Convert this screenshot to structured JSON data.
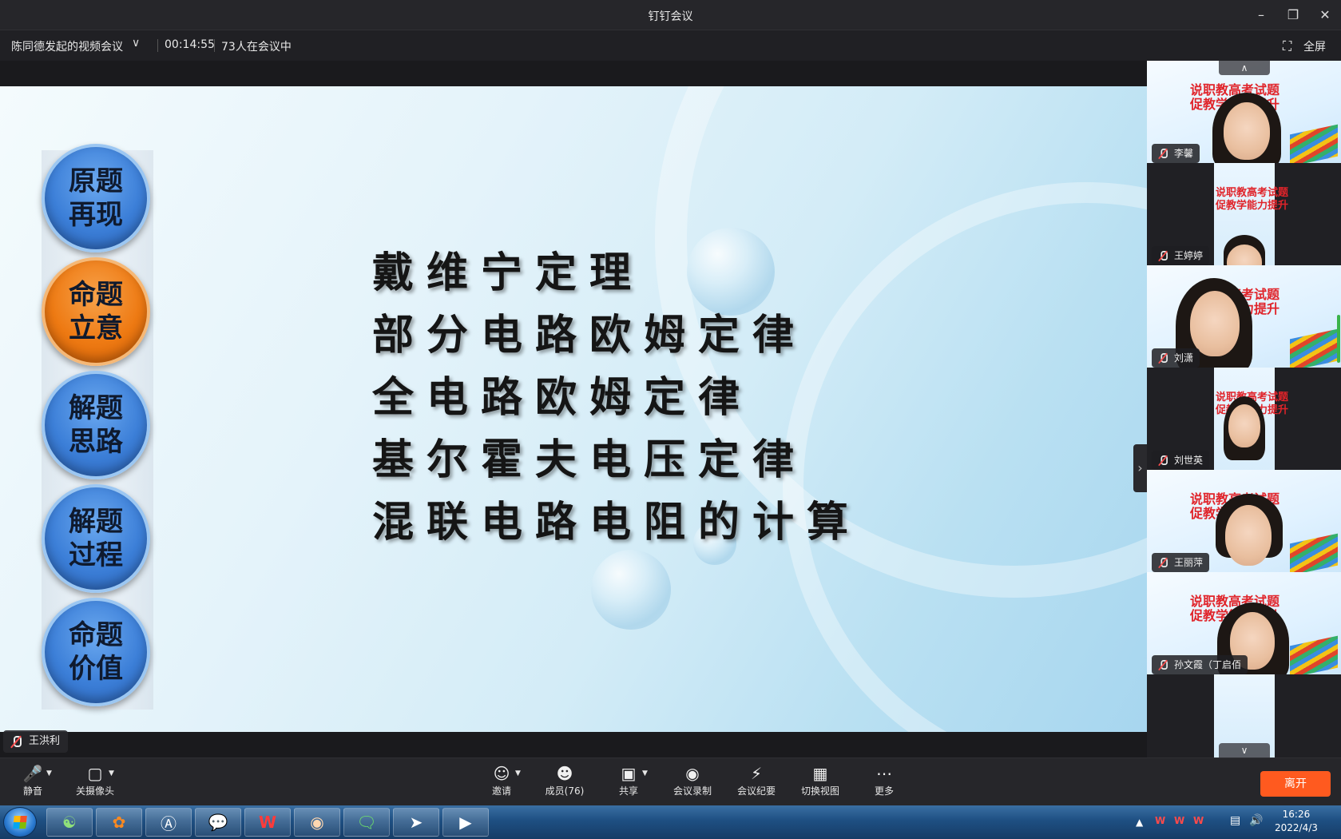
{
  "window": {
    "title": "钉钉会议",
    "minimize_icon": "minimize-icon",
    "restore_icon": "restore-icon",
    "close_icon": "close-icon"
  },
  "info_bar": {
    "meeting_name": "陈同德发起的视频会议",
    "timer": "00:14:55",
    "participants_text": "73人在会议中",
    "fullscreen_label": "全屏"
  },
  "slide": {
    "steps": [
      {
        "label": "原题\n再现",
        "active": false
      },
      {
        "label": "命题\n立意",
        "active": true
      },
      {
        "label": "解题\n思路",
        "active": false
      },
      {
        "label": "解题\n过程",
        "active": false
      },
      {
        "label": "命题\n价值",
        "active": false
      }
    ],
    "lines": [
      "戴维宁定理",
      "部分电路欧姆定律",
      "全电路欧姆定律",
      "基尔霍夫电压定律",
      "混联电路电阻的计算"
    ]
  },
  "speaker": {
    "name": "王洪利"
  },
  "banner_text": {
    "line1": "说职教高考试题",
    "line2": "促教学能力提升"
  },
  "participants": [
    {
      "name": "李馨",
      "layout": "wide"
    },
    {
      "name": "王婷婷",
      "layout": "narrow"
    },
    {
      "name": "刘潇",
      "layout": "wide"
    },
    {
      "name": "刘世英",
      "layout": "narrow"
    },
    {
      "name": "王丽萍",
      "layout": "wide"
    },
    {
      "name": "孙文霞（丁启佰",
      "layout": "wide"
    }
  ],
  "toolbar": {
    "mute": "静音",
    "camera": "关摄像头",
    "invite": "邀请",
    "members": "成员(76)",
    "share": "共享",
    "record": "会议录制",
    "minutes": "会议纪要",
    "switch_view": "切换视图",
    "more": "更多",
    "leave": "离开"
  },
  "taskbar": {
    "time": "16:26",
    "date": "2022/4/3"
  },
  "colors": {
    "leave_button": "#ff5a1f",
    "active_step": "#ee7a13",
    "step": "#3c7fd8",
    "banner_red": "#e0242a"
  }
}
